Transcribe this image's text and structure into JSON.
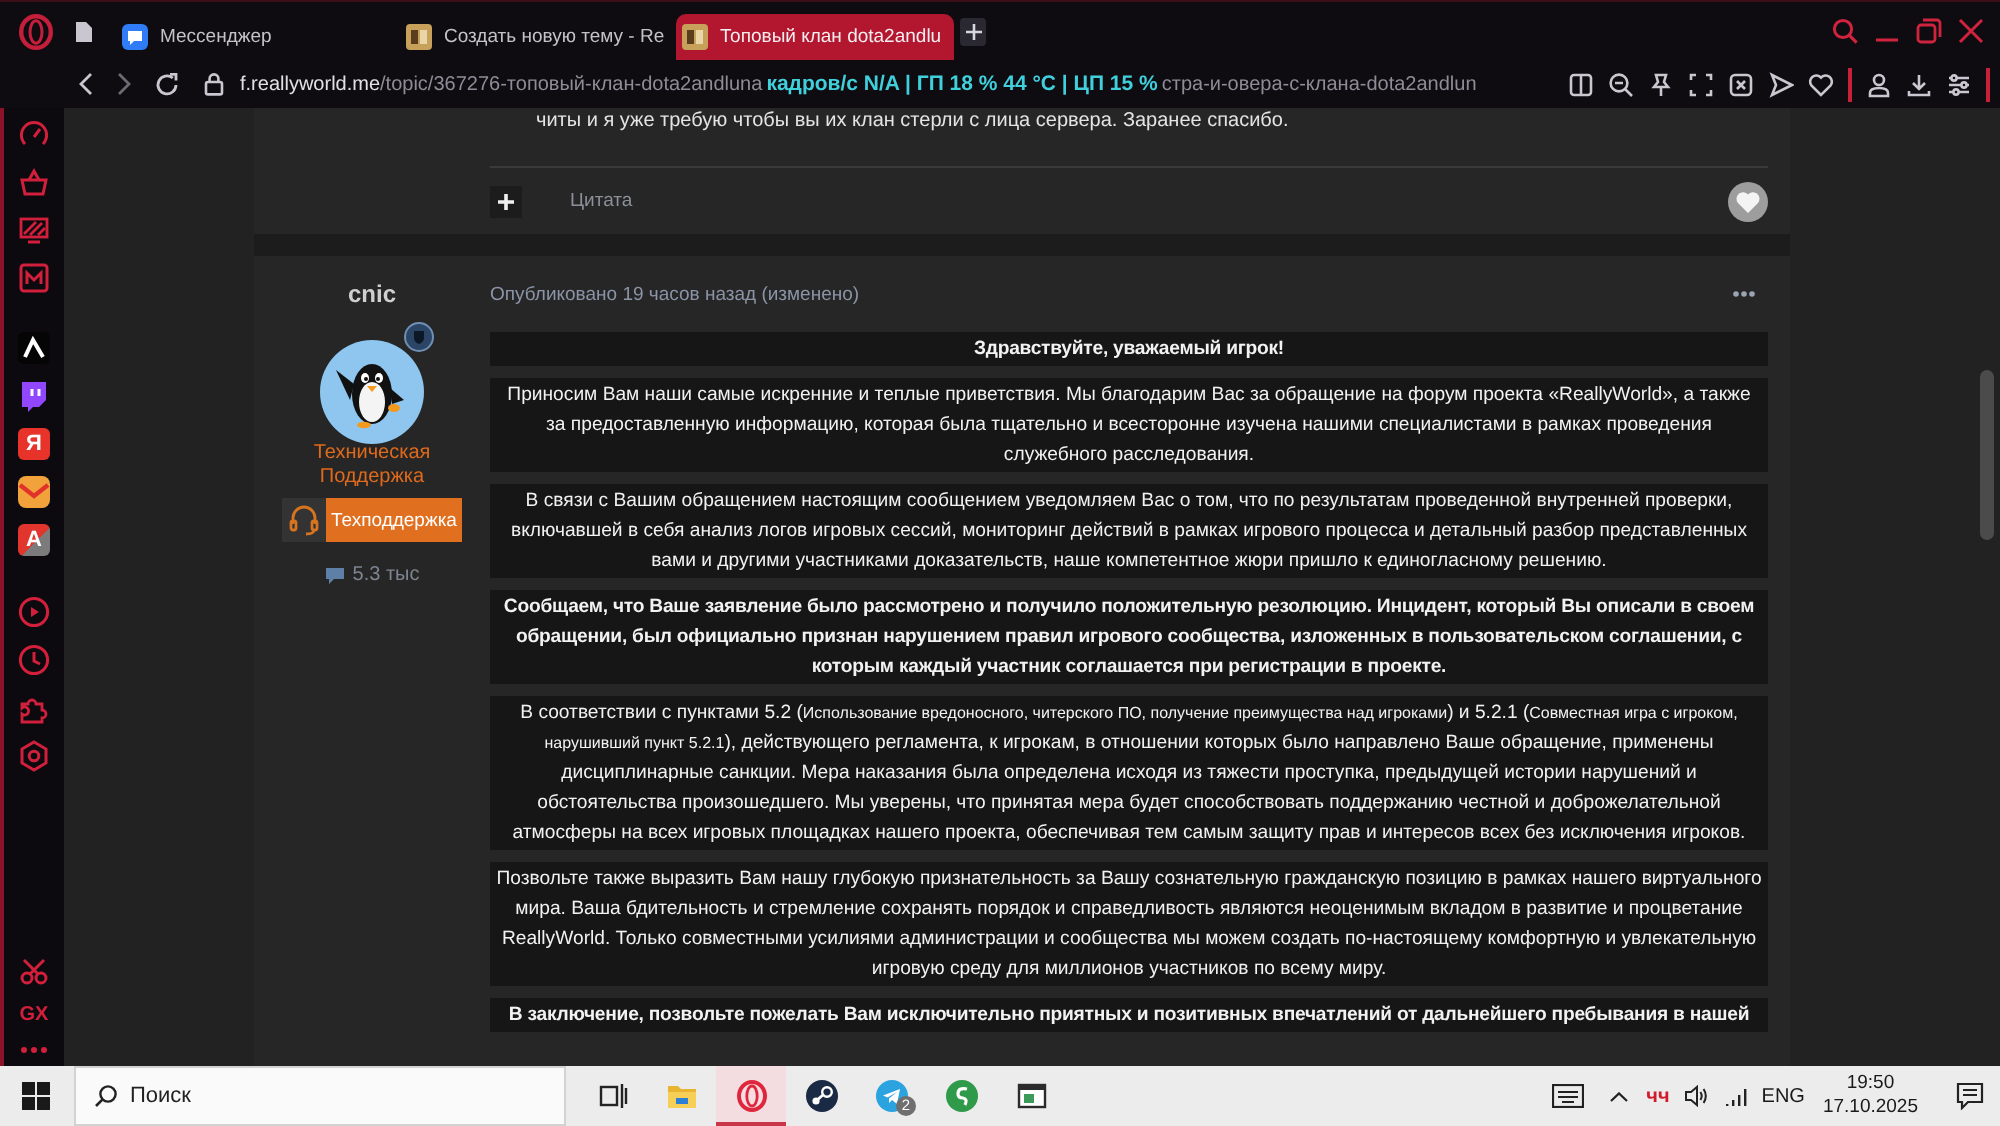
{
  "browser": {
    "tabs": [
      {
        "title": "Мессенджер",
        "kind": "messenger",
        "selected": false
      },
      {
        "title": "Создать новую тему - Re",
        "kind": "page",
        "selected": false
      },
      {
        "title": "Топовый клан dota2andlu",
        "kind": "page",
        "selected": true
      }
    ],
    "address": {
      "host": "f.reallyworld.me",
      "path": "/topic/367276-топовый-клан-dota2andluna",
      "tail": "стра-и-овера-с-клана-dota2andlun"
    },
    "overlay": "кадров/с N/A | ГП 18 % 44 °C | ЦП 15 %"
  },
  "sidebar": {
    "letter_tiles": [
      "Я",
      "A"
    ],
    "gx_label": "GX"
  },
  "previous_post": {
    "text": "читы и я уже требую чтобы вы их клан стерли с лица сервера. Заранее спасибо.",
    "quote_label": "Цитата"
  },
  "post": {
    "author": "cnic",
    "role": "Техническая Поддержка",
    "group": "Техподдержка",
    "post_count": "5.3 тыс",
    "meta": "Опубликовано 19 часов назад (изменено)",
    "paragraphs": [
      {
        "bold": true,
        "runs": [
          {
            "kind": "normal",
            "text": "Здравствуйте, уважаемый игрок!"
          }
        ]
      },
      {
        "bold": false,
        "runs": [
          {
            "kind": "normal",
            "text": "Приносим Вам наши самые искренние и теплые приветствия. Мы благодарим Вас за обращение на форум проекта «ReallyWorld», а также за предоставленную информацию, которая была тщательно и всесторонне изучена нашими специалистами в рамках проведения служебного расследования."
          }
        ]
      },
      {
        "bold": false,
        "runs": [
          {
            "kind": "normal",
            "text": "В связи с Вашим обращением настоящим сообщением уведомляем Вас о том, что по результатам проведенной внутренней проверки, включавшей в себя анализ логов игровых сессий, мониторинг действий в рамках игрового процесса и детальный разбор представленных вами и другими участниками доказательств, наше компетентное жюри пришло к единогласному решению."
          }
        ]
      },
      {
        "bold": true,
        "runs": [
          {
            "kind": "normal",
            "text": "Сообщаем, что Ваше заявление было рассмотрено и получило положительную резолюцию. Инцидент, который Вы описали в своем обращении, был официально признан нарушением правил игрового сообщества, изложенных в пользовательском соглашении, с которым каждый участник соглашается при регистрации в проекте."
          }
        ]
      },
      {
        "bold": false,
        "runs": [
          {
            "kind": "normal",
            "text": "В соответствии с пунктами 5.2 ("
          },
          {
            "kind": "small",
            "text": "Использование вредоносного, читерского ПО, получение преимущества над игроками"
          },
          {
            "kind": "normal",
            "text": ") и 5.2.1 ("
          },
          {
            "kind": "small",
            "text": "Совместная игра с игроком, нарушивший пункт 5.2.1"
          },
          {
            "kind": "normal",
            "text": "), действующего регламента, к игрокам, в отношении которых было направлено Ваше обращение, применены дисциплинарные санкции. Мера наказания была определена исходя из тяжести проступка, предыдущей истории нарушений и обстоятельства произошедшего. Мы уверены, что принятая мера будет способствовать поддержанию честной и доброжелательной атмосферы на всех игровых площадках нашего проекта, обеспечивая тем самым защиту прав и интересов всех без исключения игроков."
          }
        ]
      },
      {
        "bold": false,
        "runs": [
          {
            "kind": "normal",
            "text": "Позвольте также выразить Вам нашу глубокую признательность за Вашу сознательную гражданскую позицию в рамках нашего виртуального мира. Ваша бдительность и стремление сохранять порядок и справедливость являются неоценимым вкладом в развитие и процветание ReallyWorld. Только совместными усилиями администрации и сообщества мы можем создать по-настоящему комфортную и увлекательную игровую среду для миллионов участников по всему миру."
          }
        ]
      },
      {
        "bold": true,
        "runs": [
          {
            "kind": "normal",
            "text": "В заключение, позвольте пожелать Вам исключительно приятных и позитивных впечатлений от дальнейшего пребывания в нашей"
          }
        ]
      }
    ]
  },
  "taskbar": {
    "search": {
      "placeholder": "Поиск"
    },
    "buttons": [
      {
        "selected": false
      },
      {
        "selected": false
      },
      {
        "selected": true
      },
      {
        "selected": false
      },
      {
        "selected": false,
        "badge": "2"
      },
      {
        "selected": false
      },
      {
        "selected": false
      }
    ],
    "tray": {
      "indicator": "чч",
      "language": "ENG",
      "time": "19:50",
      "date": "17.10.2025"
    }
  }
}
